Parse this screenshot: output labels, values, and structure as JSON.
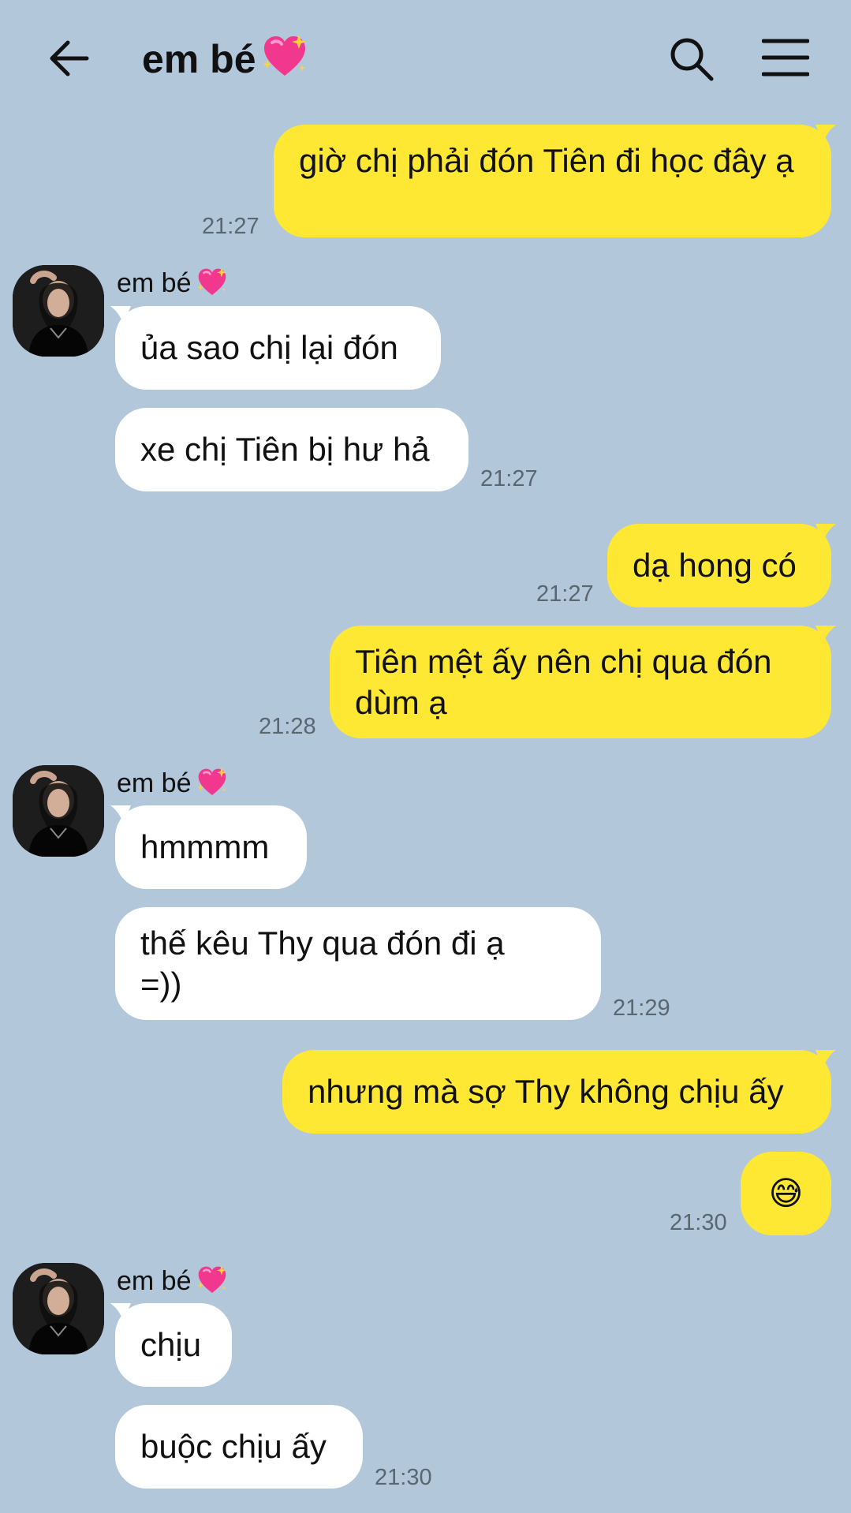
{
  "header": {
    "title": "em bé",
    "title_emoji": "sparkling-heart-icon"
  },
  "contact": {
    "name": "em bé"
  },
  "messages": [
    {
      "from": "me",
      "text": "giờ chị phải đón Tiên đi học đây ạ",
      "time": "21:27"
    },
    {
      "from": "them",
      "text": "ủa sao chị lại đón"
    },
    {
      "from": "them",
      "text": "xe chị Tiên bị hư hả",
      "time": "21:27"
    },
    {
      "from": "me",
      "text": "dạ hong có",
      "time": "21:27"
    },
    {
      "from": "me",
      "text": "Tiên mệt ấy nên chị qua đón dùm ạ",
      "time": "21:28"
    },
    {
      "from": "them",
      "text": "hmmmm"
    },
    {
      "from": "them",
      "text": "thế kêu Thy qua đón đi ạ =))",
      "time": "21:29"
    },
    {
      "from": "me",
      "text": "nhưng mà sợ Thy không chịu ấy"
    },
    {
      "from": "me",
      "text": "😅",
      "time": "21:30"
    },
    {
      "from": "them",
      "text": "chịu"
    },
    {
      "from": "them",
      "text": "buộc chịu ấy",
      "time": "21:30"
    }
  ],
  "colors": {
    "background": "#b2c7da",
    "my_bubble": "#fee833",
    "their_bubble": "#ffffff",
    "timestamp": "#5a6670"
  }
}
